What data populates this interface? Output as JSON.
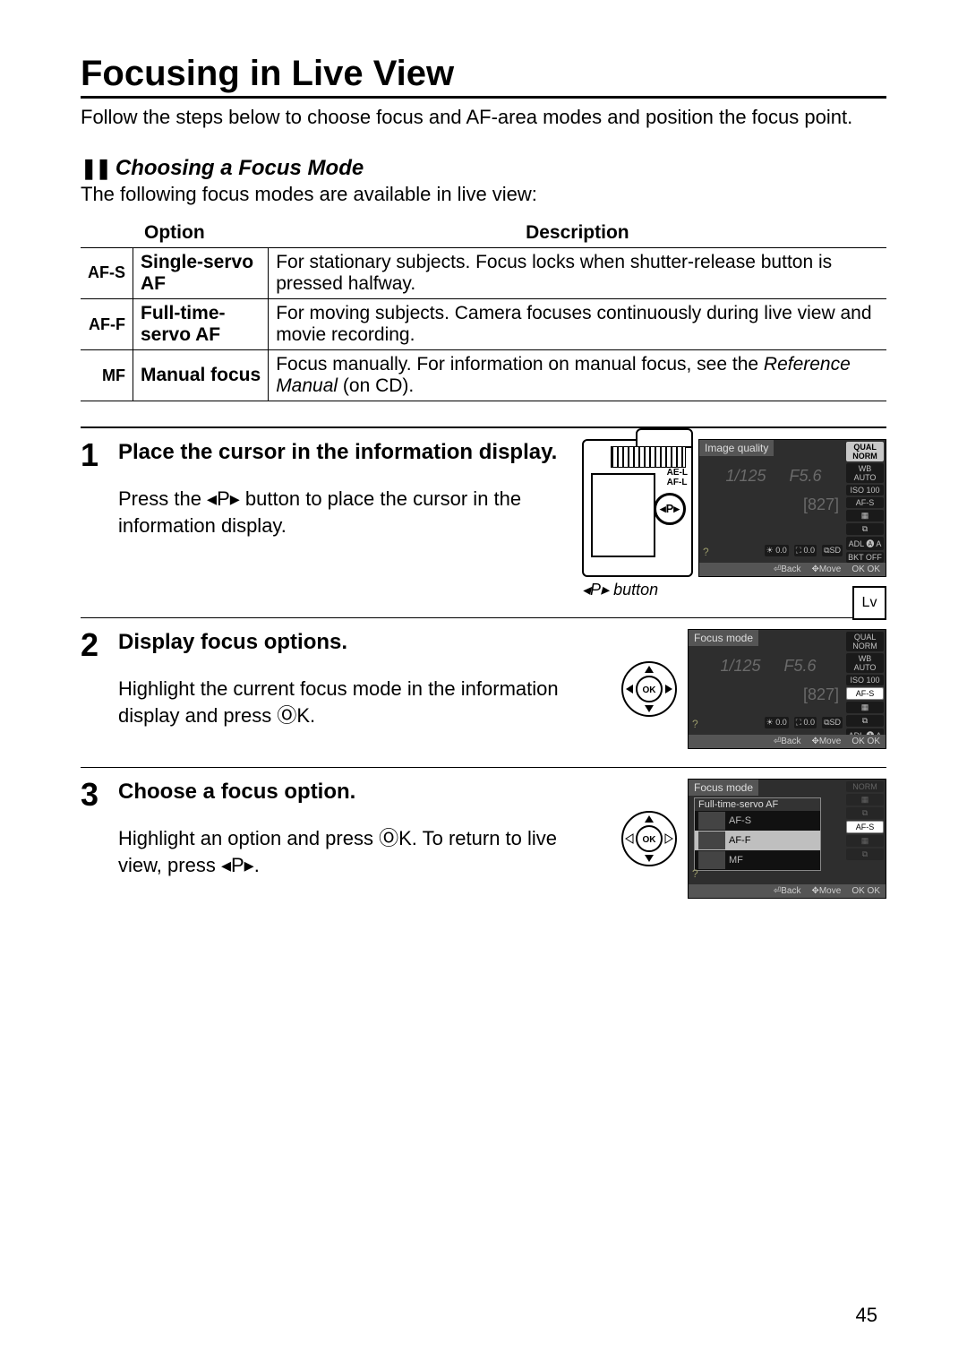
{
  "page_number": "45",
  "title": "Focusing in Live View",
  "intro": "Follow the steps below to choose focus and AF-area modes and position the focus point.",
  "section": {
    "marker": "❚❚",
    "heading": "Choosing a Focus Mode",
    "lead": "The following focus modes are available in live view:"
  },
  "table": {
    "headers": {
      "option": "Option",
      "description": "Description"
    },
    "rows": [
      {
        "icon": "AF-S",
        "name_l1": "Single-servo",
        "name_l2": "AF",
        "desc": "For stationary subjects. Focus locks when shutter-release button is pressed halfway."
      },
      {
        "icon": "AF-F",
        "name_l1": "Full-time-",
        "name_l2": "servo AF",
        "desc": "For moving subjects. Camera focuses continuously during live view and movie recording."
      },
      {
        "icon": "MF",
        "name_l1": "Manual focus",
        "name_l2": "",
        "desc_a": "Focus manually.  For information on manual focus, see the ",
        "desc_ref": "Reference Manual",
        "desc_b": " (on CD)."
      }
    ]
  },
  "glyphs": {
    "info_btn": "⬚P⬚",
    "ok_btn": "J"
  },
  "steps": {
    "s1": {
      "num": "1",
      "title": "Place the cursor in the information display.",
      "body_a": "Press the ",
      "body_b": " button to place the cursor in the information display.",
      "caption_prefix": "",
      "caption": " button"
    },
    "s2": {
      "num": "2",
      "title": "Display focus options.",
      "body_a": "Highlight the current focus mode in the information display and press ",
      "body_b": "."
    },
    "s3": {
      "num": "3",
      "title": "Choose a focus option.",
      "body_a": "Highlight an option and press ",
      "body_b": ".  To return to live view, press ",
      "body_c": "."
    }
  },
  "info_display": {
    "title_iq": "Image quality",
    "title_fm": "Focus mode",
    "title_fm_sub": "Full-time-servo AF",
    "shutter": "1/125",
    "aperture": "F5.6",
    "exposures": "[827]",
    "side": {
      "qual": "QUAL",
      "norm": "NORM",
      "wb": "WB",
      "auto": "AUTO",
      "iso": "ISO",
      "iso_v": "100",
      "afs": "AF-S",
      "aff": "AF-F",
      "mf": "MF",
      "adl": "ADL",
      "adla": "🅐 A",
      "bkt": "BKT",
      "off": "OFF"
    },
    "bottom": {
      "ev1": "0.0",
      "ev2": "0.0",
      "sd": "⧉SD"
    },
    "foot": {
      "back": "⏎Back",
      "move": "✥Move",
      "ok": "OK OK"
    },
    "q": "?"
  },
  "side_tab": "Lv"
}
